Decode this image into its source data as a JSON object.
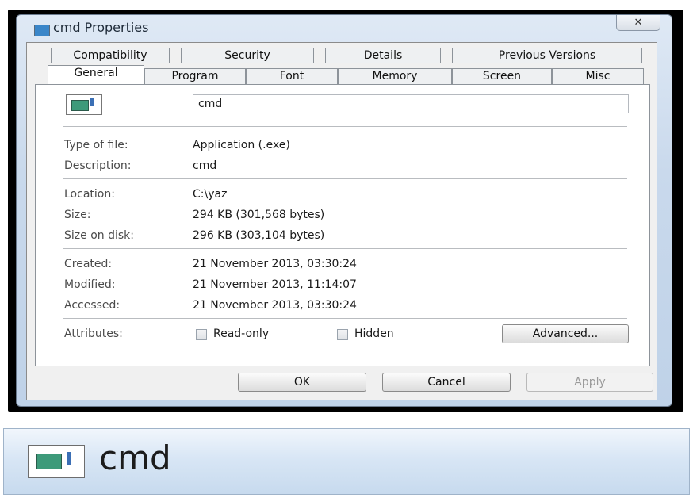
{
  "window": {
    "title": "cmd Properties",
    "close_label": "✕"
  },
  "tabs_back": [
    "Compatibility",
    "Security",
    "Details",
    "Previous Versions"
  ],
  "tabs_front": [
    "General",
    "Program",
    "Font",
    "Memory",
    "Screen",
    "Misc"
  ],
  "general": {
    "name_value": "cmd",
    "type_label": "Type of file:",
    "type_value": "Application (.exe)",
    "description_label": "Description:",
    "description_value": "cmd",
    "location_label": "Location:",
    "location_value": "C:\\yaz",
    "size_label": "Size:",
    "size_value": "294 KB (301,568 bytes)",
    "size_on_disk_label": "Size on disk:",
    "size_on_disk_value": "296 KB (303,104 bytes)",
    "created_label": "Created:",
    "created_value": "21 November 2013, 03:30:24",
    "modified_label": "Modified:",
    "modified_value": "21 November 2013, 11:14:07",
    "accessed_label": "Accessed:",
    "accessed_value": "21 November 2013, 03:30:24",
    "attributes_label": "Attributes:",
    "readonly_label": "Read-only",
    "hidden_label": "Hidden",
    "advanced_label": "Advanced..."
  },
  "buttons": {
    "ok": "OK",
    "cancel": "Cancel",
    "apply": "Apply"
  },
  "taskbar": {
    "label": "cmd",
    "icon": "console-app-icon"
  }
}
